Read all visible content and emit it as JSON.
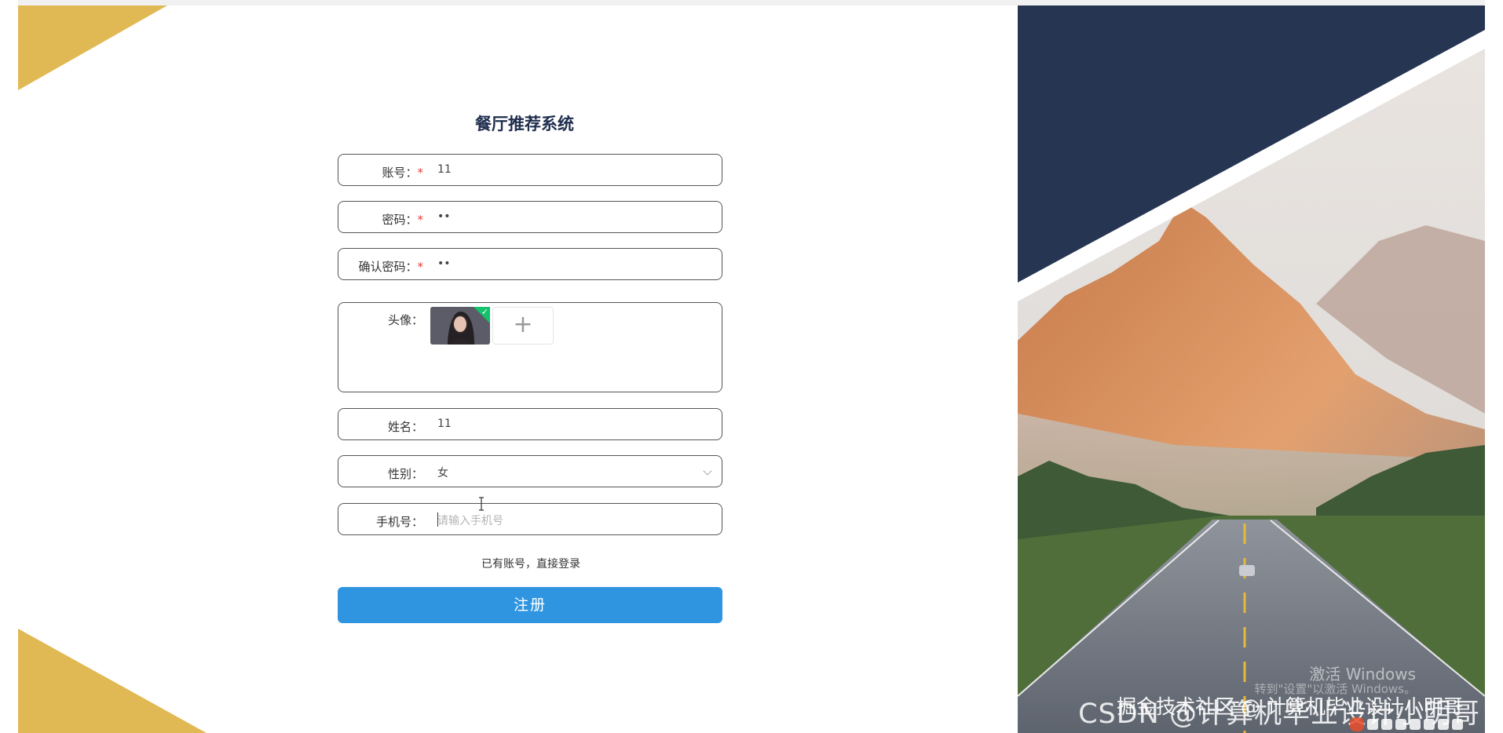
{
  "app": {
    "title": "餐厅推荐系统"
  },
  "colors": {
    "accent": "#3095e0",
    "gold": "#e1b954",
    "navy": "#263552",
    "required": "#e23b3b"
  },
  "form": {
    "account": {
      "label": "账号：",
      "required_mark": "*",
      "value": "11"
    },
    "password": {
      "label": "密码：",
      "required_mark": "*",
      "value": "••"
    },
    "confirm_password": {
      "label": "确认密码：",
      "required_mark": "*",
      "value": "••"
    },
    "avatar": {
      "label": "头像：",
      "upload_icon": "plus-icon"
    },
    "name": {
      "label": "姓名：",
      "value": "11"
    },
    "gender": {
      "label": "性别：",
      "value": "女"
    },
    "phone": {
      "label": "手机号：",
      "placeholder": "请输入手机号"
    }
  },
  "login_link": "已有账号，直接登录",
  "register_button": "注册",
  "overlay": {
    "activation_title": "激活 Windows",
    "activation_subtitle": "转到\"设置\"以激活 Windows。",
    "csdn_watermark": "CSDN @计算机毕业设计小明哥",
    "juejin_watermark": "掘金技术社区 @ 计算机毕业设计小明哥"
  }
}
